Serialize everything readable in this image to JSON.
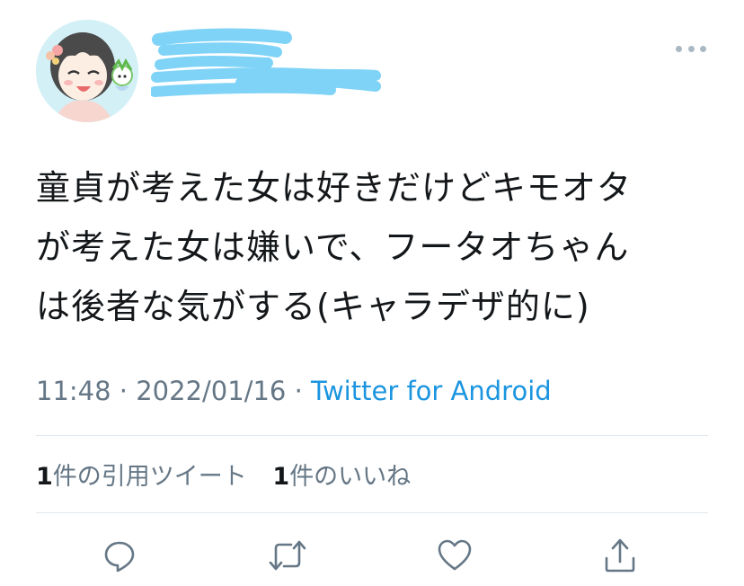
{
  "tweet": {
    "text": "童貞が考えた女は好きだけどキモオタ\nが考えた女は嫌いで、フータオちゃん\nは後者な気がする(キャラデザ的に)",
    "time": "11:48",
    "separator": "·",
    "date": "2022/01/16",
    "source": "Twitter for Android"
  },
  "stats": {
    "quotes_count": "1",
    "quotes_label": "件の引用ツイート",
    "likes_count": "1",
    "likes_label": "件のいいね"
  },
  "actions": [
    "reply-icon",
    "retweet-icon",
    "like-icon",
    "share-icon"
  ],
  "colors": {
    "text": "#14171a",
    "secondary": "#657786",
    "link": "#1b95e0",
    "divider": "#e1e8ed",
    "redaction": "#7fd3f7",
    "icon": "#657786"
  }
}
